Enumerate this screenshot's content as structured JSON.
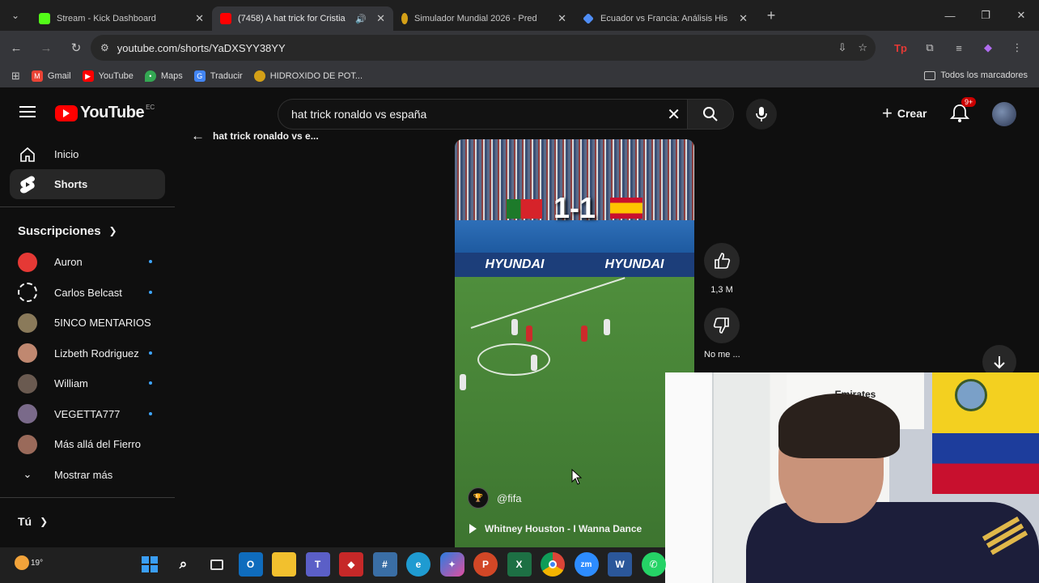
{
  "browser": {
    "tabs": [
      {
        "title": "Stream - Kick Dashboard",
        "favicon_color": "#53fc18",
        "active": false
      },
      {
        "title": "(7458) A hat trick for Cristia",
        "favicon_color": "#ff0000",
        "active": true
      },
      {
        "title": "Simulador Mundial 2026 - Pred",
        "favicon_color": "#d4a017",
        "active": false
      },
      {
        "title": "Ecuador vs Francia: Análisis His",
        "favicon_color": "#4f8df5",
        "active": false
      }
    ],
    "url": "youtube.com/shorts/YaDXSYY38YY",
    "bookmarks": [
      {
        "label": "Gmail",
        "color": "#ea4335"
      },
      {
        "label": "YouTube",
        "color": "#ff0000"
      },
      {
        "label": "Maps",
        "color": "#34a853"
      },
      {
        "label": "Traducir",
        "color": "#4285f4"
      },
      {
        "label": "HIDROXIDO DE POT...",
        "color": "#d4a017"
      }
    ],
    "all_bookmarks": "Todos los marcadores"
  },
  "youtube": {
    "logo_text": "YouTube",
    "country": "EC",
    "search_value": "hat trick ronaldo vs españa",
    "create_label": "Crear",
    "notification_badge": "9+",
    "sidebar": {
      "home": "Inicio",
      "shorts": "Shorts",
      "subscriptions_title": "Suscripciones",
      "subscriptions": [
        {
          "name": "Auron",
          "new": true,
          "color": "#e53935"
        },
        {
          "name": "Carlos Belcast",
          "new": true,
          "color": "#f5f5f5"
        },
        {
          "name": "5INCO MENTARIOS",
          "new": false,
          "color": "#8a7a5a"
        },
        {
          "name": "Lizbeth Rodriguez",
          "new": true,
          "color": "#c08870"
        },
        {
          "name": "William",
          "new": true,
          "color": "#6a5a50"
        },
        {
          "name": "VEGETTA777",
          "new": true,
          "color": "#7a6a8a"
        },
        {
          "name": "Más allá del Fierro",
          "new": false,
          "color": "#9a6a5a"
        }
      ],
      "show_more": "Mostrar más",
      "you": "Tú"
    },
    "back_label": "hat trick ronaldo vs e...",
    "short": {
      "score": "1-1",
      "channel": "@fifa",
      "music": "Whitney Houston - I Wanna Dance",
      "likes": "1,3 M",
      "dislike_label": "No me ...",
      "board_text": "HYUNDAI"
    }
  },
  "webcam": {
    "shirt_text": "Emirates"
  },
  "taskbar": {
    "temperature": "19°"
  }
}
